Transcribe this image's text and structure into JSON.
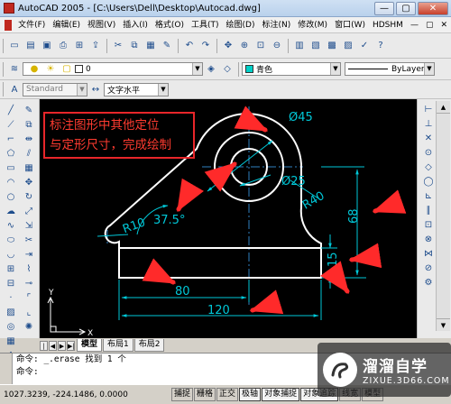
{
  "window": {
    "title": "AutoCAD 2005 - [C:\\Users\\Dell\\Desktop\\Autocad.dwg]",
    "minimize": "—",
    "maximize": "▢",
    "close": "✕"
  },
  "menu": {
    "items": [
      "文件(F)",
      "编辑(E)",
      "视图(V)",
      "插入(I)",
      "格式(O)",
      "工具(T)",
      "绘图(D)",
      "标注(N)",
      "修改(M)",
      "窗口(W)",
      "HDSHM"
    ],
    "doc_controls": [
      "—",
      "▢",
      "✕"
    ]
  },
  "layers": {
    "current_layer": "0",
    "color": "青色",
    "linetype": "ByLayer",
    "color_swatch": "#00d0c8"
  },
  "styles": {
    "text_style": "Standard",
    "dim_style": "文字水平"
  },
  "drawing": {
    "annotation_lines": [
      "标注图形中其他定位",
      "与定形尺寸，完成绘制"
    ],
    "dims": {
      "dia45": "Ø45",
      "dia25": "Ø25",
      "r40": "R40",
      "r10": "R10",
      "angle": "37.5°",
      "h68": "68",
      "h15": "15",
      "w80": "80",
      "w120": "120"
    },
    "line_color": "#ffffff",
    "dim_color": "#00c8d8",
    "center_color": "#2f7fbf",
    "arrow_color": "#ff2a2a",
    "ucs_y": "Y",
    "ucs_x": "X"
  },
  "layout_tabs": {
    "tabs": [
      "模型",
      "布局1",
      "布局2"
    ]
  },
  "command": {
    "line1": "命令: _.erase 找到 1 个",
    "line2": "命令:"
  },
  "status": {
    "coords": "1027.3239, -224.1486, 0.0000",
    "buttons": [
      "捕捉",
      "栅格",
      "正交",
      "极轴",
      "对象捕捉",
      "对象追踪",
      "线宽",
      "模型"
    ],
    "on_states": [
      false,
      false,
      false,
      true,
      true,
      true,
      false,
      false
    ]
  },
  "watermark": {
    "name": "溜溜自学",
    "url": "ZIXUE.3D66.COM"
  }
}
